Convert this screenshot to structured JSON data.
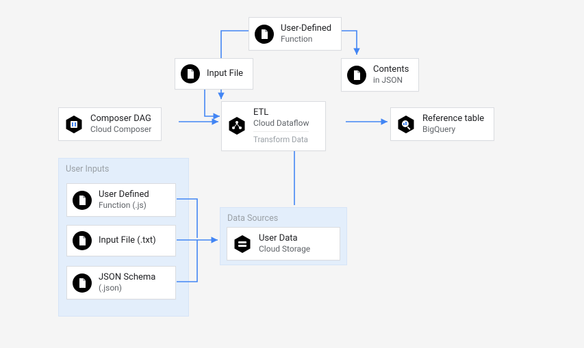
{
  "nodes": {
    "udf_top": {
      "title": "User-Defined",
      "subtitle": "Function"
    },
    "input_file_top": {
      "title": "Input File"
    },
    "contents_json": {
      "title": "Contents",
      "subtitle": "in JSON"
    },
    "composer": {
      "title": "Composer DAG",
      "subtitle": "Cloud Composer"
    },
    "etl": {
      "title": "ETL",
      "subtitle": "Cloud Dataflow",
      "subtitle2": "Transform Data"
    },
    "bigquery": {
      "title": "Reference table",
      "subtitle": "BigQuery"
    },
    "ui_udf": {
      "title": "User Defined",
      "subtitle": "Function (.js)"
    },
    "ui_txt": {
      "title": "Input File (.txt)"
    },
    "ui_json": {
      "title": "JSON Schema",
      "subtitle": "(.json)"
    },
    "userdata": {
      "title": "User Data",
      "subtitle": "Cloud Storage"
    }
  },
  "groups": {
    "user_inputs": {
      "title": "User Inputs"
    },
    "data_sources": {
      "title": "Data Sources"
    }
  }
}
